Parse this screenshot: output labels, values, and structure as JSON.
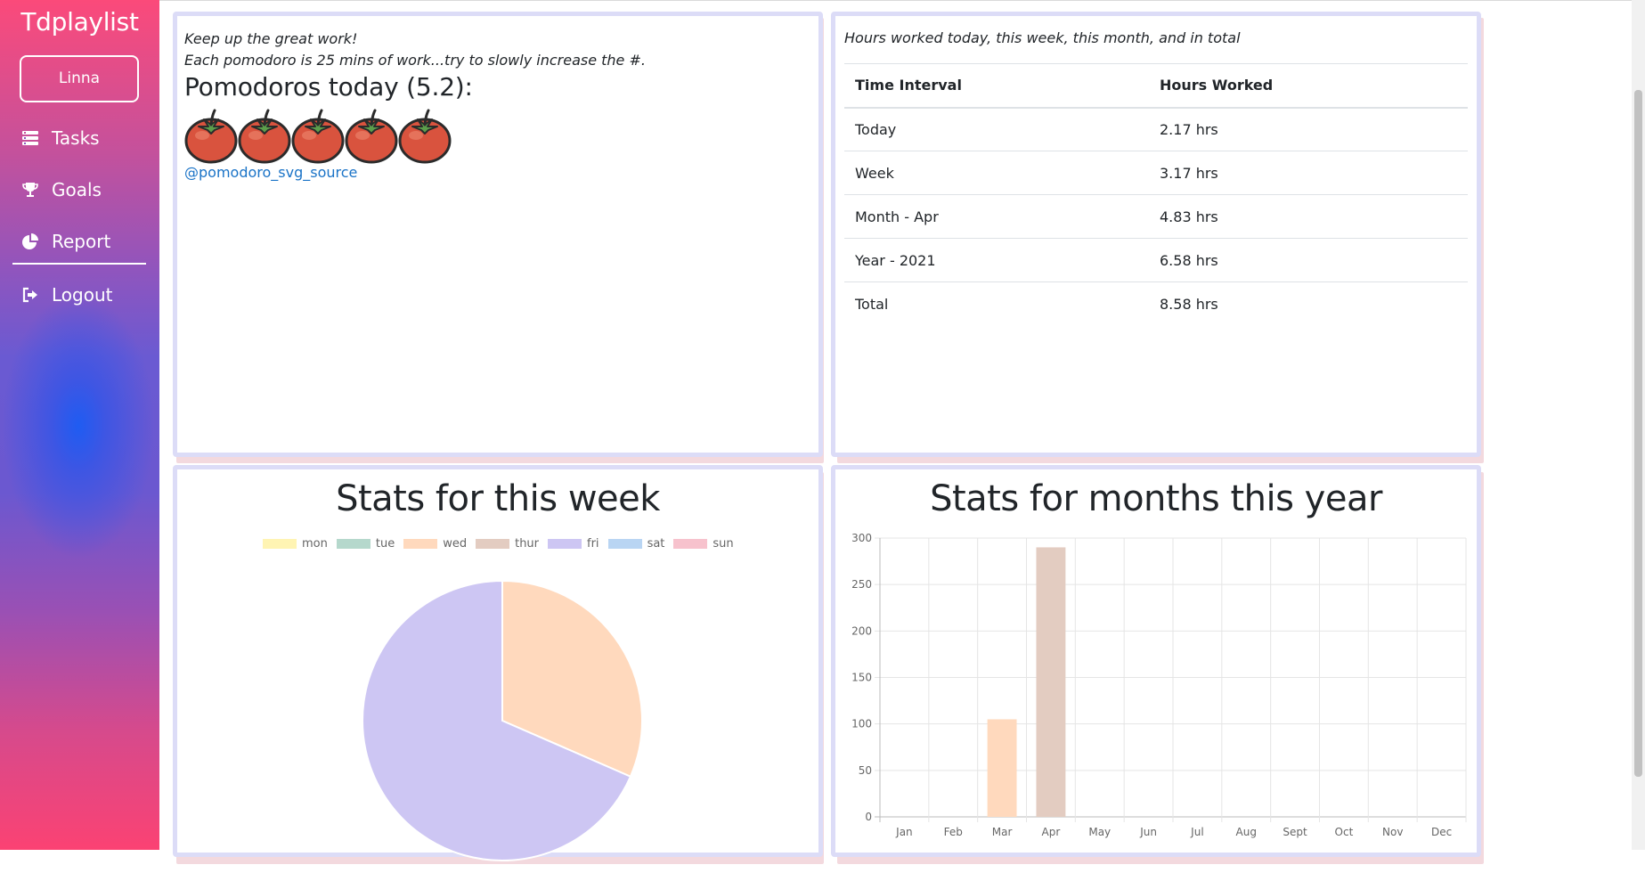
{
  "sidebar": {
    "brand": "Tdplaylist",
    "user_button": "Linna",
    "items": [
      {
        "label": "Tasks",
        "icon": "tasks-icon"
      },
      {
        "label": "Goals",
        "icon": "trophy-icon"
      },
      {
        "label": "Report",
        "icon": "pie-chart-icon"
      },
      {
        "label": "Logout",
        "icon": "logout-icon"
      }
    ]
  },
  "pomodoro": {
    "encouragement": "Keep up the great work!",
    "note": "Each pomodoro is 25 mins of work...try to slowly increase the #.",
    "title": "Pomodoros today (5.2):",
    "count": 5,
    "credit": "@pomodoro_svg_source"
  },
  "hours": {
    "caption": "Hours worked today, this week, this month, and in total",
    "headers": [
      "Time Interval",
      "Hours Worked"
    ],
    "rows": [
      [
        "Today",
        "2.17 hrs"
      ],
      [
        "Week",
        "3.17 hrs"
      ],
      [
        "Month - Apr",
        "4.83 hrs"
      ],
      [
        "Year - 2021",
        "6.58 hrs"
      ],
      [
        "Total",
        "8.58 hrs"
      ]
    ]
  },
  "week_chart": {
    "title": "Stats for this week"
  },
  "month_chart": {
    "title": "Stats for months this year"
  },
  "chart_data": [
    {
      "type": "pie",
      "title": "Stats for this week",
      "categories": [
        "mon",
        "tue",
        "wed",
        "thur",
        "fri",
        "sat",
        "sun"
      ],
      "values": [
        0,
        0,
        1,
        0,
        2.17,
        0,
        0
      ],
      "colors": [
        "#fff4b3",
        "#b5d8cc",
        "#ffd9bd",
        "#e3ccc1",
        "#cdc6f3",
        "#b9d5f3",
        "#f7c2cd"
      ],
      "legend": "top"
    },
    {
      "type": "bar",
      "title": "Stats for months this year",
      "categories": [
        "Jan",
        "Feb",
        "Mar",
        "Apr",
        "May",
        "Jun",
        "Jul",
        "Aug",
        "Sept",
        "Oct",
        "Nov",
        "Dec"
      ],
      "values": [
        0,
        0,
        105,
        290,
        0,
        0,
        0,
        0,
        0,
        0,
        0,
        0
      ],
      "colors": [
        "#fff4b3",
        "#b5d8cc",
        "#ffd9bd",
        "#e3ccc1",
        "#cdc6f3",
        "#b9d5f3",
        "#f7c2cd",
        "#fff4b3",
        "#b5d8cc",
        "#ffd9bd",
        "#e3ccc1",
        "#cdc6f3"
      ],
      "ylim": [
        0,
        300
      ],
      "yticks": [
        0,
        50,
        100,
        150,
        200,
        250,
        300
      ],
      "grid": true
    }
  ]
}
